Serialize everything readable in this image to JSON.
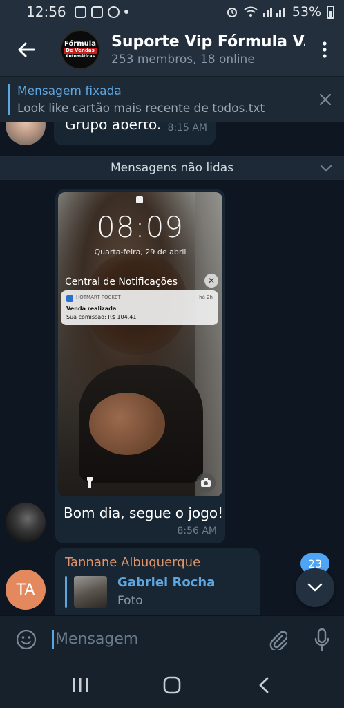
{
  "status_bar": {
    "time": "12:56",
    "battery": "53%"
  },
  "header": {
    "title": "Suporte Vip Fórmula V...",
    "subtitle": "253 membros, 18 online",
    "avatar_logo": {
      "line1": "Fórmula",
      "line2": "De Vendas",
      "line3": "Automáticas"
    }
  },
  "pinned": {
    "title": "Mensagem fixada",
    "text": "Look like cartão mais recente de todos.txt"
  },
  "messages": {
    "msg1": {
      "text": "Grupo aberto.",
      "time": "8:15 AM"
    },
    "unread_divider": "Mensagens não lidas",
    "msg2": {
      "photo": {
        "clock": "08:09",
        "date": "Quarta-feira, 29 de abril",
        "notification_center": "Central de Notificações",
        "notif_app": "HOTMART POCKET",
        "notif_age": "há 2h",
        "notif_title": "Venda realizada",
        "notif_text": "Sua comissão: R$ 104,41"
      },
      "text": "Bom dia, segue o jogo!",
      "time": "8:56 AM"
    },
    "msg3": {
      "sender": "Tannane Albuquerque",
      "reply_name": "Gabriel Rocha",
      "reply_type": "Foto",
      "avatar_initials": "TA"
    }
  },
  "scroll_badge": "23",
  "input": {
    "placeholder": "Mensagem"
  },
  "colors": {
    "accent": "#5ea6e0",
    "sender": "#e0966a",
    "badge": "#4ea4f5",
    "bubble": "#182533",
    "background": "#0e1621"
  }
}
